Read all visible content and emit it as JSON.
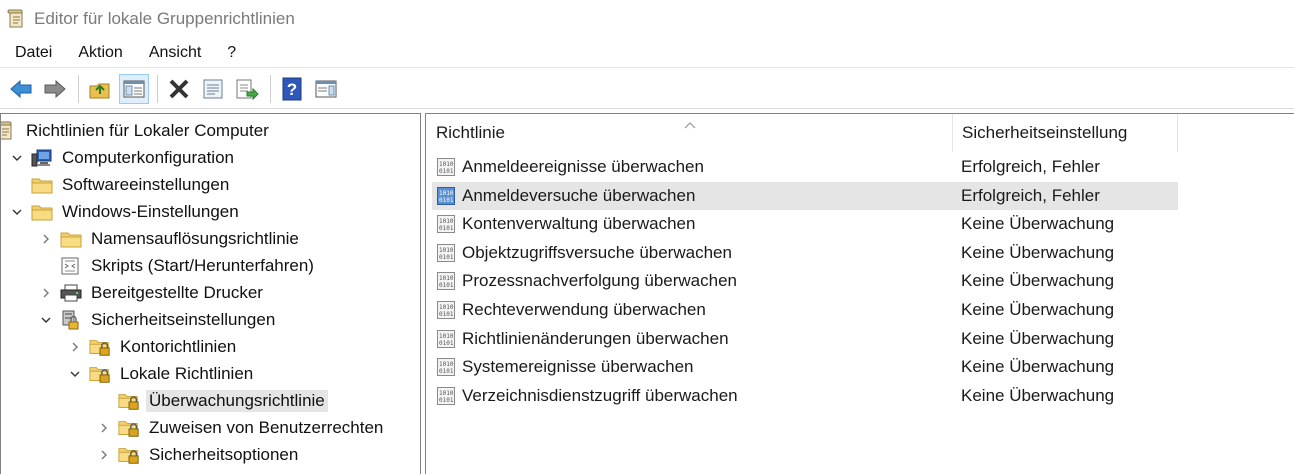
{
  "window": {
    "title": "Editor für lokale Gruppenrichtlinien",
    "app_icon": "policy-scroll-icon"
  },
  "menu": [
    "Datei",
    "Aktion",
    "Ansicht",
    "?"
  ],
  "toolbar": [
    {
      "name": "back-button",
      "icon": "arrow-left-icon"
    },
    {
      "name": "forward-button",
      "icon": "arrow-right-icon"
    },
    {
      "name": "up-folder-button",
      "icon": "folder-up-icon"
    },
    {
      "name": "show-hide-tree-button",
      "icon": "console-tree-icon",
      "active": true
    },
    {
      "name": "delete-button",
      "icon": "delete-x-icon"
    },
    {
      "name": "properties-button",
      "icon": "properties-icon"
    },
    {
      "name": "export-list-button",
      "icon": "export-list-icon"
    },
    {
      "name": "help-button",
      "icon": "help-icon"
    },
    {
      "name": "show-action-pane-button",
      "icon": "action-pane-icon"
    }
  ],
  "tree": [
    {
      "label": "Richtlinien für Lokaler Computer",
      "level": 0,
      "expander": "none",
      "icon": "policy-scroll-icon"
    },
    {
      "label": "Computerkonfiguration",
      "level": 0,
      "expander": "open",
      "icon": "computer-icon"
    },
    {
      "label": "Softwareeinstellungen",
      "level": 1,
      "expander": "none",
      "icon": "folder-icon"
    },
    {
      "label": "Windows-Einstellungen",
      "level": 1,
      "expander": "open",
      "icon": "folder-icon"
    },
    {
      "label": "Namensauflösungsrichtlinie",
      "level": 2,
      "expander": "closed",
      "icon": "folder-icon"
    },
    {
      "label": "Skripts (Start/Herunterfahren)",
      "level": 2,
      "expander": "none",
      "icon": "script-icon"
    },
    {
      "label": "Bereitgestellte Drucker",
      "level": 2,
      "expander": "closed",
      "icon": "printer-icon"
    },
    {
      "label": "Sicherheitseinstellungen",
      "level": 2,
      "expander": "open",
      "icon": "security-settings-icon"
    },
    {
      "label": "Kontorichtlinien",
      "level": 3,
      "expander": "closed",
      "icon": "lock-folder-icon"
    },
    {
      "label": "Lokale Richtlinien",
      "level": 3,
      "expander": "open",
      "icon": "lock-folder-icon"
    },
    {
      "label": "Überwachungsrichtlinie",
      "level": 4,
      "expander": "none",
      "icon": "lock-folder-icon",
      "selected": true
    },
    {
      "label": "Zuweisen von Benutzerrechten",
      "level": 4,
      "expander": "closed",
      "icon": "lock-folder-icon"
    },
    {
      "label": "Sicherheitsoptionen",
      "level": 4,
      "expander": "closed",
      "icon": "lock-folder-icon"
    }
  ],
  "list": {
    "columns": [
      "Richtlinie",
      "Sicherheitseinstellung"
    ],
    "rows": [
      {
        "name": "Anmeldeereignisse überwachen",
        "value": "Erfolgreich, Fehler"
      },
      {
        "name": "Anmeldeversuche überwachen",
        "value": "Erfolgreich, Fehler",
        "highlight": true
      },
      {
        "name": "Kontenverwaltung überwachen",
        "value": "Keine Überwachung"
      },
      {
        "name": "Objektzugriffsversuche überwachen",
        "value": "Keine Überwachung"
      },
      {
        "name": "Prozessnachverfolgung überwachen",
        "value": "Keine Überwachung"
      },
      {
        "name": "Rechteverwendung überwachen",
        "value": "Keine Überwachung"
      },
      {
        "name": "Richtlinienänderungen überwachen",
        "value": "Keine Überwachung"
      },
      {
        "name": "Systemereignisse überwachen",
        "value": "Keine Überwachung"
      },
      {
        "name": "Verzeichnisdienstzugriff überwachen",
        "value": "Keine Überwachung"
      }
    ]
  }
}
